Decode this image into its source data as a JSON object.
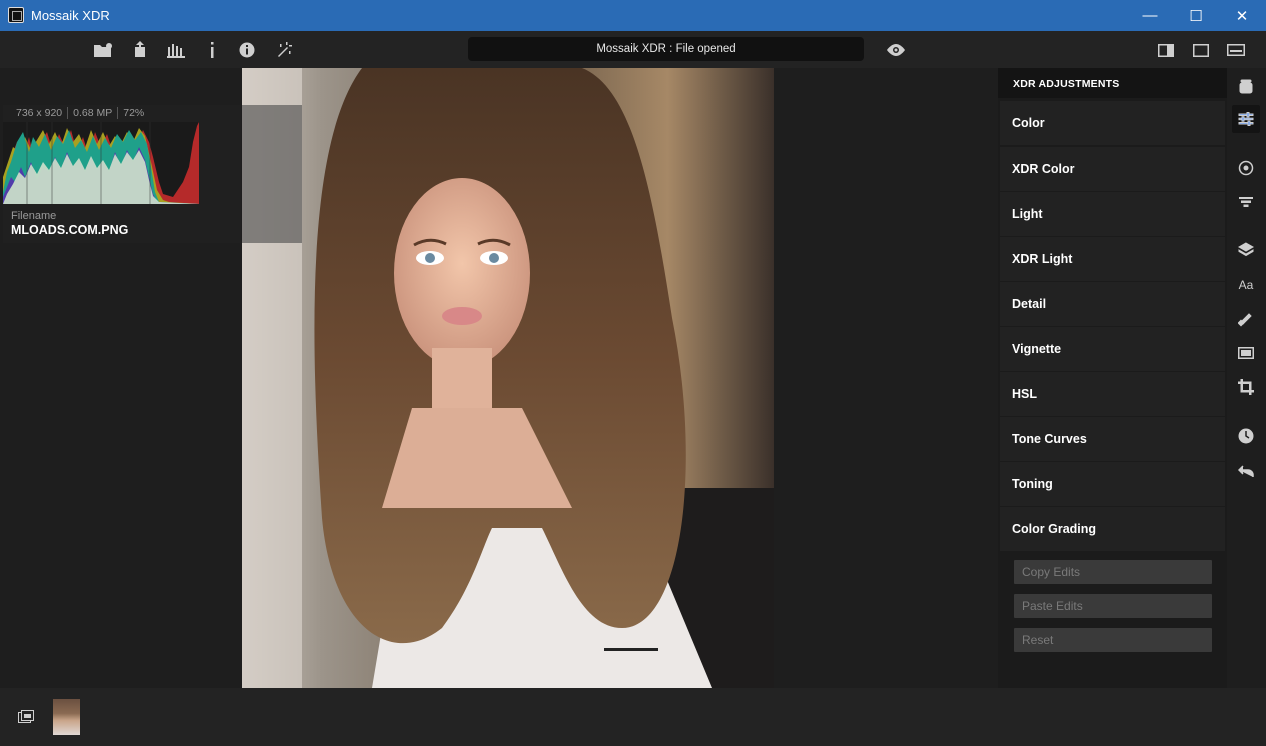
{
  "window": {
    "title": "Mossaik XDR",
    "controls": {
      "minimize": "—",
      "maximize": "☐",
      "close": "✕"
    }
  },
  "toolbar": {
    "status": "Mossaik XDR : File opened",
    "icons": [
      "open-folder-icon",
      "export-icon",
      "histogram-icon",
      "info-i-icon",
      "info-circle-icon",
      "magic-wand-icon",
      "eye-icon",
      "layout-split-icon",
      "layout-single-icon",
      "layout-filmstrip-icon"
    ]
  },
  "info": {
    "dimensions": "736 x 920",
    "megapixels": "0.68 MP",
    "zoom": "72%",
    "filename_label": "Filename",
    "filename": "MLOADS.COM.PNG"
  },
  "adjustments": {
    "header": "XDR ADJUSTMENTS",
    "items": [
      "Color",
      "XDR Color",
      "Light",
      "XDR Light",
      "Detail",
      "Vignette",
      "HSL",
      "Tone Curves",
      "Toning",
      "Color Grading"
    ],
    "buttons": {
      "copy": "Copy Edits",
      "paste": "Paste Edits",
      "reset": "Reset"
    }
  },
  "rail_icons": [
    "presets-icon",
    "adjustments-icon",
    "radial-icon",
    "filter-icon",
    "layers-icon",
    "text-icon",
    "heal-icon",
    "frame-icon",
    "crop-icon",
    "history-icon",
    "undo-icon"
  ],
  "bottom": {
    "icons": [
      "browse-icon"
    ]
  },
  "colors": {
    "titlebar": "#2a6bb5",
    "accent_active": "#4a8cff"
  }
}
